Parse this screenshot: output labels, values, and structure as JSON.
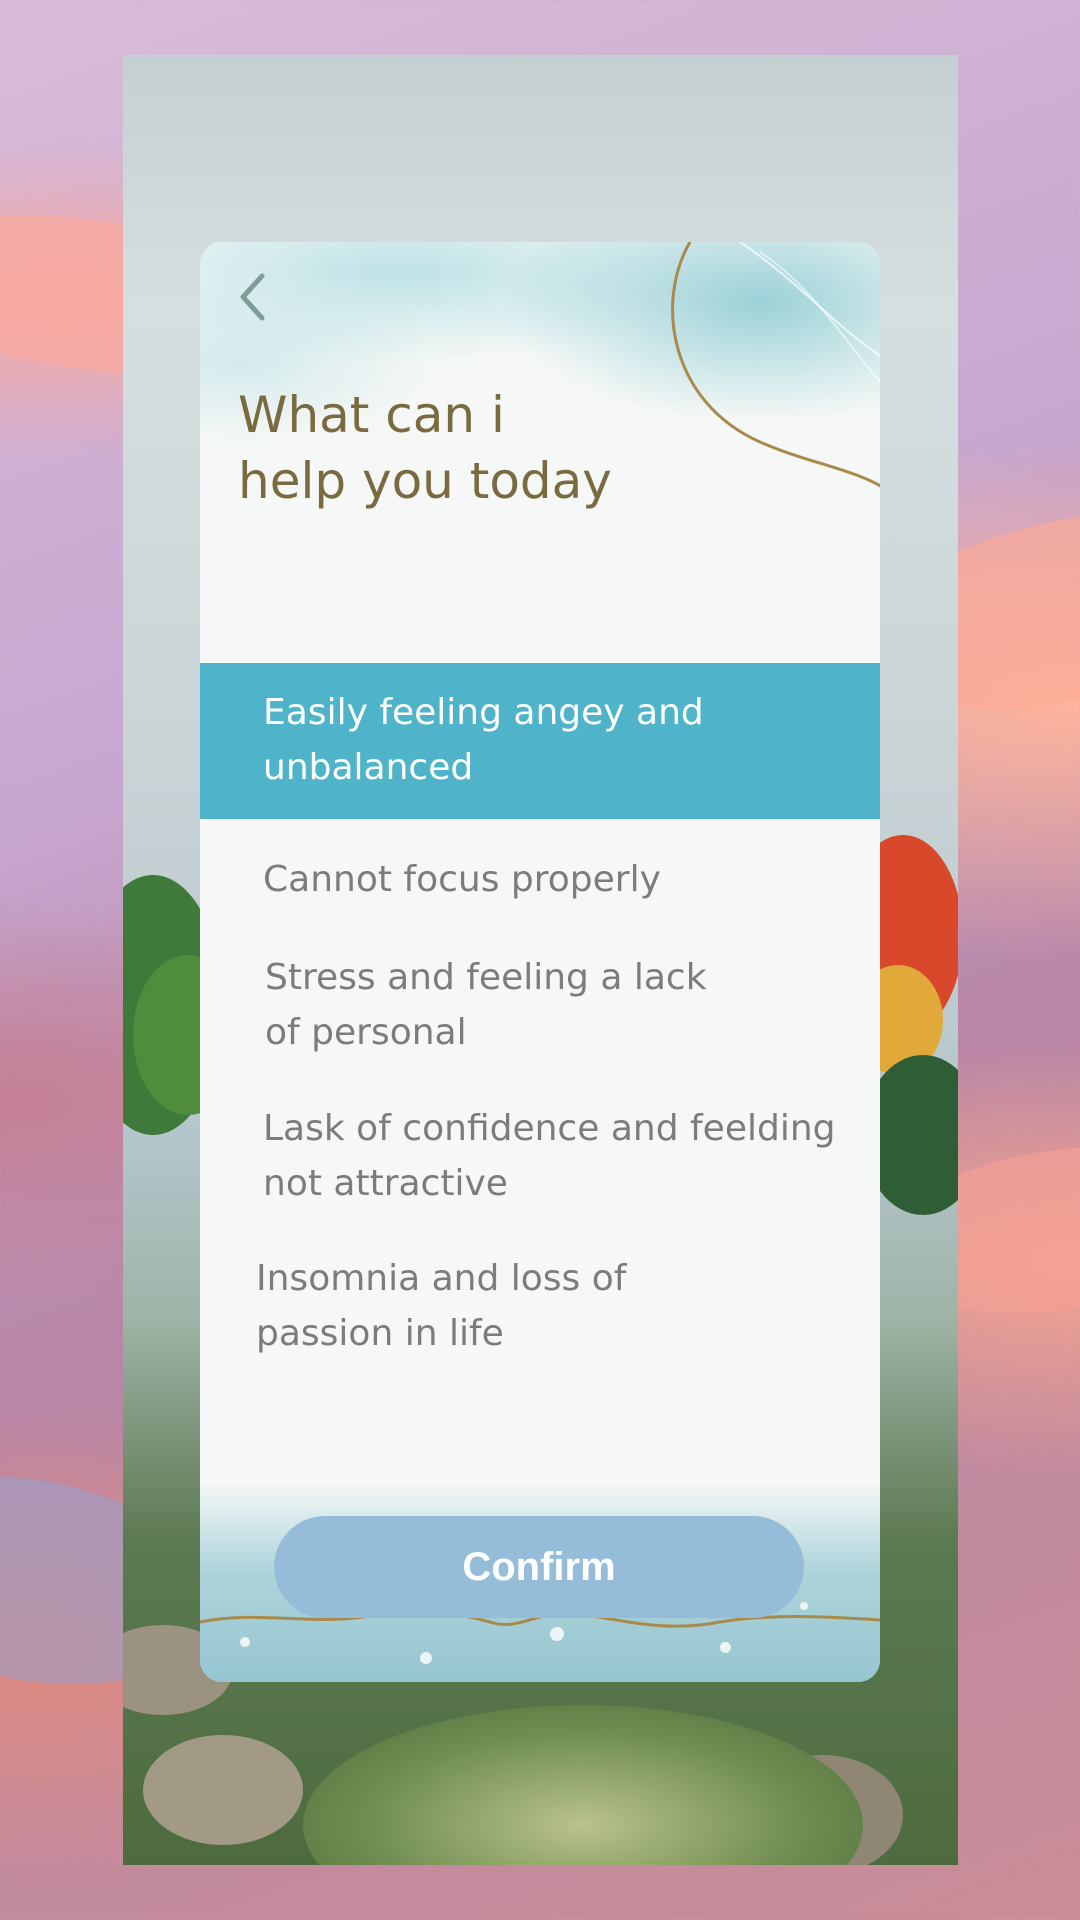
{
  "colors": {
    "selected_option_bg": "#4fb4c9",
    "title_text": "#7a6a3f",
    "option_text": "#7c7c7a",
    "confirm_bg": "#95bcd8",
    "card_bg": "#f5f8f6",
    "gold_line": "#a88a4c"
  },
  "icons": {
    "back": "chevron-left-icon"
  },
  "card": {
    "title": "What can i\nhelp you today",
    "options": [
      {
        "label": "Easily feeling angey and\nunbalanced",
        "selected": true
      },
      {
        "label": "Cannot focus properly",
        "selected": false
      },
      {
        "label": "Stress and feeling a lack\nof personal",
        "selected": false
      },
      {
        "label": "Lask of confidence and feelding\nnot attractive",
        "selected": false
      },
      {
        "label": "Insomnia and loss of\npassion in life",
        "selected": false
      }
    ],
    "confirm_label": "Confirm"
  }
}
